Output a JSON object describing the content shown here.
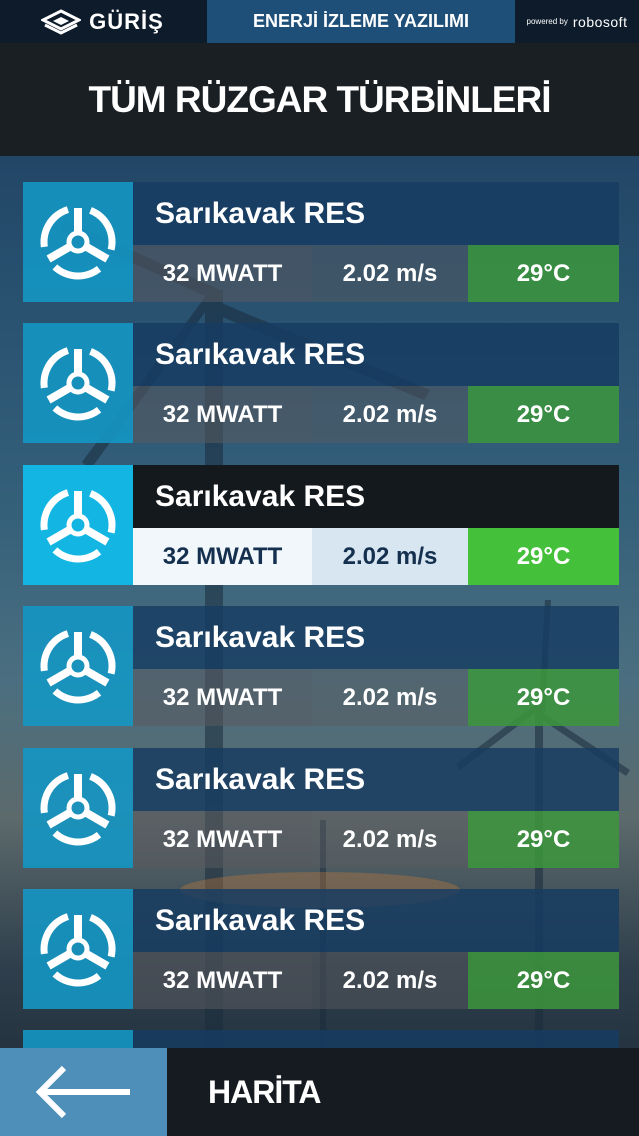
{
  "topbar": {
    "brand": "GÜRİŞ",
    "app_title": "ENERJİ İZLEME YAZILIMI",
    "powered_by": "powered by",
    "powered_brand": "robosoft"
  },
  "header": {
    "title": "TÜM RÜZGAR TÜRBİNLERİ"
  },
  "turbines": [
    {
      "name": "Sarıkavak RES",
      "power": "32 MWATT",
      "wind": "2.02 m/s",
      "temp": "29°C"
    },
    {
      "name": "Sarıkavak RES",
      "power": "32 MWATT",
      "wind": "2.02 m/s",
      "temp": "29°C"
    },
    {
      "name": "Sarıkavak RES",
      "power": "32 MWATT",
      "wind": "2.02 m/s",
      "temp": "29°C"
    },
    {
      "name": "Sarıkavak RES",
      "power": "32 MWATT",
      "wind": "2.02 m/s",
      "temp": "29°C"
    },
    {
      "name": "Sarıkavak RES",
      "power": "32 MWATT",
      "wind": "2.02 m/s",
      "temp": "29°C"
    },
    {
      "name": "Sarıkavak RES",
      "power": "32 MWATT",
      "wind": "2.02 m/s",
      "temp": "29°C"
    }
  ],
  "active_index": 2,
  "bottom": {
    "map_label": "HARİTA"
  },
  "icons": {
    "turbine": "turbine-icon",
    "back": "arrow-left-icon",
    "logo": "guris-logo-icon"
  },
  "colors": {
    "accent": "#13b6e3",
    "temp_active": "#44c03a",
    "temp": "#3c963c",
    "back_button": "#4d8fb9"
  }
}
